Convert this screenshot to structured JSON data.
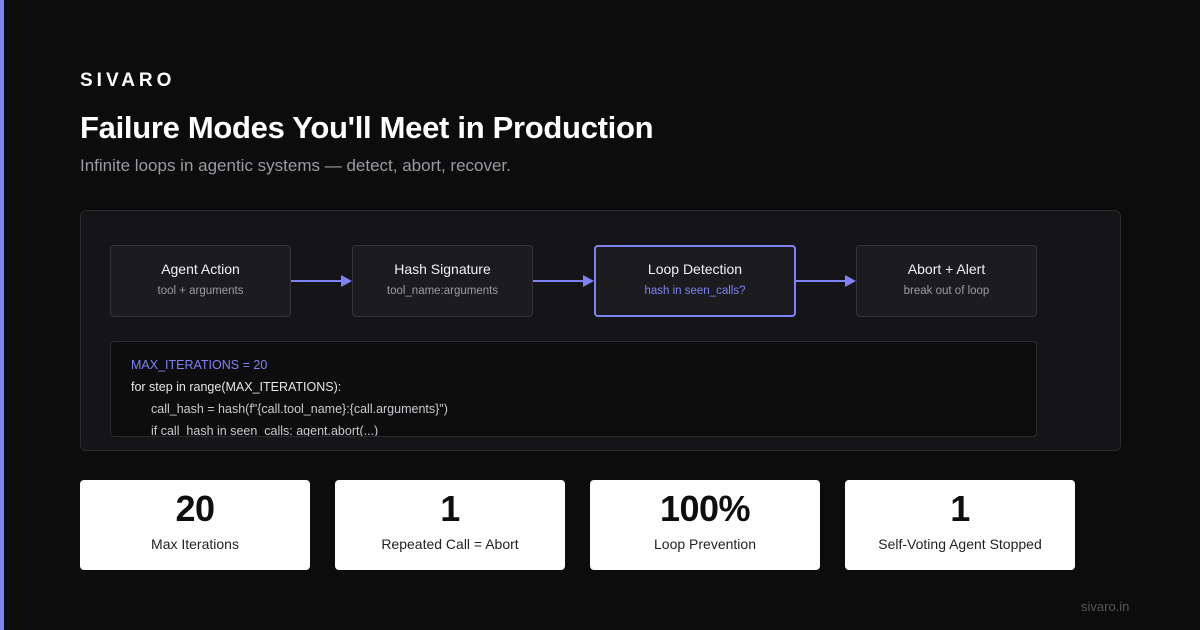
{
  "colors": {
    "accent": "#7d83f5",
    "background": "#0c0c0d",
    "panel": "#151517"
  },
  "brand": "SIVARO",
  "title": "Failure Modes You'll Meet in Production",
  "subtitle": "Infinite loops in agentic systems — detect, abort, recover.",
  "flow": {
    "nodes": [
      {
        "title": "Agent Action",
        "subtitle": "tool + arguments",
        "highlighted": false
      },
      {
        "title": "Hash Signature",
        "subtitle": "tool_name:arguments",
        "highlighted": false
      },
      {
        "title": "Loop Detection",
        "subtitle": "hash in seen_calls?",
        "highlighted": true
      },
      {
        "title": "Abort + Alert",
        "subtitle": "break out of loop",
        "highlighted": false
      }
    ]
  },
  "code": {
    "lines": [
      "MAX_ITERATIONS = 20",
      "for step in range(MAX_ITERATIONS):",
      "call_hash = hash(f\"{call.tool_name}:{call.arguments}\")",
      "if call_hash in seen_calls: agent.abort(...)"
    ]
  },
  "stats": [
    {
      "value": "20",
      "label": "Max Iterations"
    },
    {
      "value": "1",
      "label": "Repeated Call = Abort"
    },
    {
      "value": "100%",
      "label": "Loop Prevention"
    },
    {
      "value": "1",
      "label": "Self-Voting Agent Stopped"
    }
  ],
  "footer": "sivaro.in"
}
